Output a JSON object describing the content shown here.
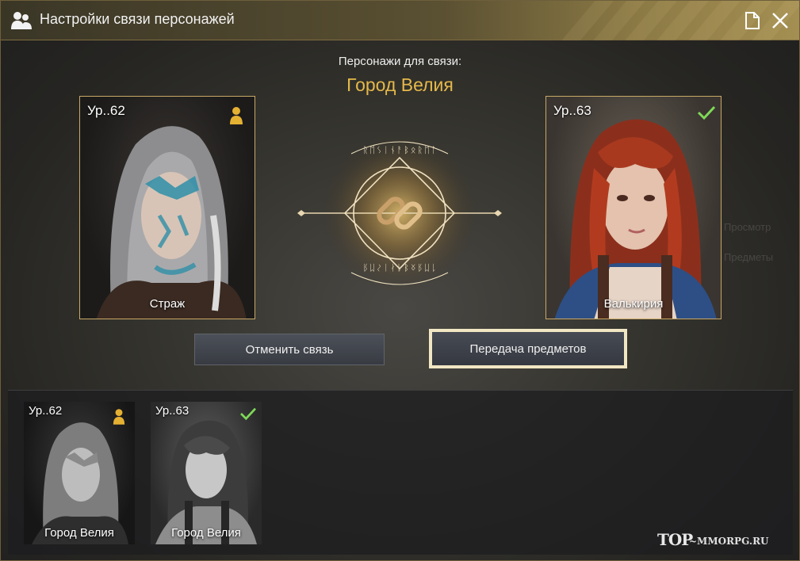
{
  "window": {
    "title": "Настройки связи персонажей",
    "accent_color": "#e5b94a",
    "frame_color": "#c9a866"
  },
  "header": {
    "subtitle": "Персонажи для связи:",
    "city": "Город Велия"
  },
  "link_emblem": {
    "icon": "chain-link-icon",
    "runes_top": "ᚱᛖᛊᛁᚾᚨᛒᛟᚱᛖᛚ",
    "runes_bottom": "ᚱᛖᛊᛁᚾᚨᛒᛟᚱᛖᛚ"
  },
  "characters": {
    "left": {
      "level": "Ур..62",
      "class_name": "Страж",
      "badge": "main-character-icon",
      "badge_color": "#e5b133"
    },
    "right": {
      "level": "Ур..63",
      "class_name": "Валькирия",
      "badge": "check-icon",
      "badge_color": "#7ed957"
    }
  },
  "actions": {
    "unlink_label": "Отменить связь",
    "transfer_label": "Передача предметов"
  },
  "character_list": [
    {
      "level": "Ур..62",
      "location": "Город Велия",
      "badge": "main-character-icon"
    },
    {
      "level": "Ур..63",
      "location": "Город Велия",
      "badge": "check-icon"
    }
  ],
  "background_menu": [
    "Просмотр",
    "Предметы"
  ],
  "watermark": {
    "text": "~MMORPG.RU",
    "logo": "TOP"
  }
}
